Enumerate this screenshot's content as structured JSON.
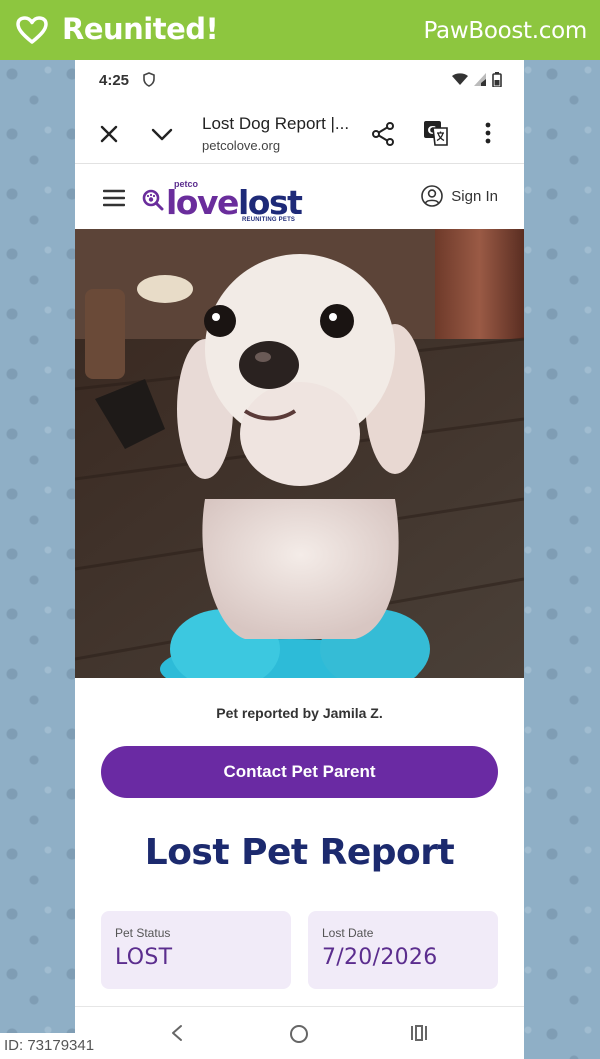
{
  "banner": {
    "title": "Reunited!",
    "brand": "PawBoost.com",
    "icon": "heart-outline-icon",
    "color": "#8dc63f"
  },
  "status_bar": {
    "time": "4:25",
    "icons": [
      "shield-icon",
      "wifi-icon",
      "signal-icon",
      "battery-icon"
    ]
  },
  "browser": {
    "page_title": "Lost Dog Report |...",
    "url": "petcolove.org",
    "icons": [
      "close-icon",
      "chevron-down-icon",
      "share-icon",
      "translate-icon",
      "more-vertical-icon"
    ]
  },
  "site_header": {
    "logo": {
      "petco": "petco",
      "love": "love",
      "lost": "lost",
      "tagline": "REUNITING PETS"
    },
    "signin_label": "Sign In"
  },
  "report": {
    "reported_by": "Pet reported by Jamila Z.",
    "contact_label": "Contact Pet Parent",
    "title": "Lost Pet Report",
    "status_label": "Pet Status",
    "status_value": "LOST",
    "date_label": "Lost Date",
    "date_value": "7/20/2026"
  },
  "colors": {
    "accent_purple": "#6a2aa3",
    "title_navy": "#1c2a6e",
    "card_bg": "#f1ebf8"
  },
  "footer": {
    "id_text": "ID: 73179341"
  }
}
